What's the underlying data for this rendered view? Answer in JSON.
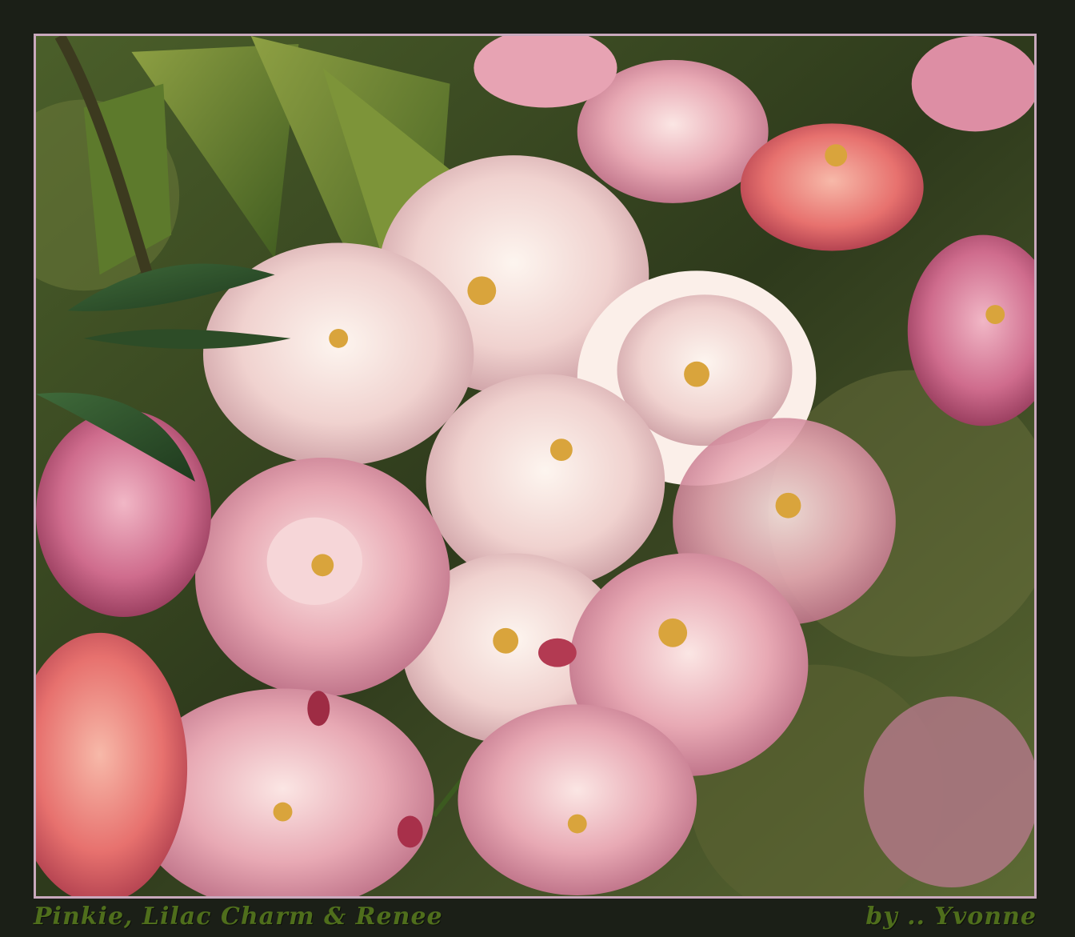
{
  "photo": {
    "subject": "flower-photo"
  },
  "caption": {
    "title": "Pinkie, Lilac Charm & Renee",
    "credit": "by  .. Yvonne"
  },
  "colors": {
    "background": "#1b1f17",
    "border": "#c9a9bd",
    "caption_text": "#4f6e1c"
  }
}
